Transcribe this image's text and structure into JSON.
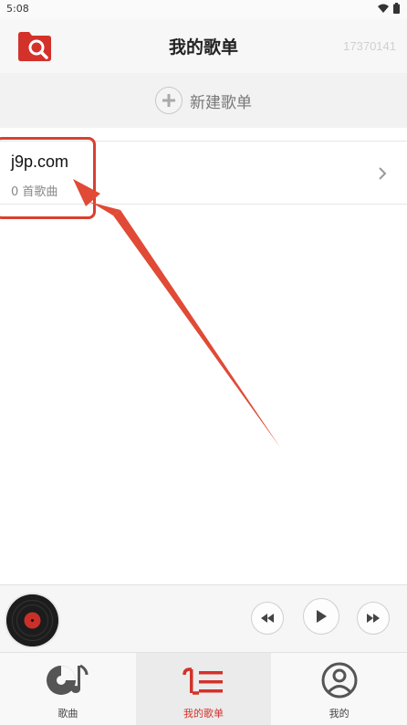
{
  "status_bar": {
    "time": "5:08"
  },
  "header": {
    "title": "我的歌单",
    "user_id": "17370141"
  },
  "new_playlist": {
    "label": "新建歌单"
  },
  "playlists": [
    {
      "name": "j9p.com",
      "count": "0 首歌曲"
    }
  ],
  "bottom_nav": {
    "tabs": [
      {
        "label": "歌曲",
        "icon": "music-disc-icon"
      },
      {
        "label": "我的歌单",
        "icon": "playlist-icon",
        "active": true
      },
      {
        "label": "我的",
        "icon": "user-icon"
      }
    ]
  },
  "colors": {
    "accent": "#d3322a",
    "annotation": "#d94030"
  }
}
